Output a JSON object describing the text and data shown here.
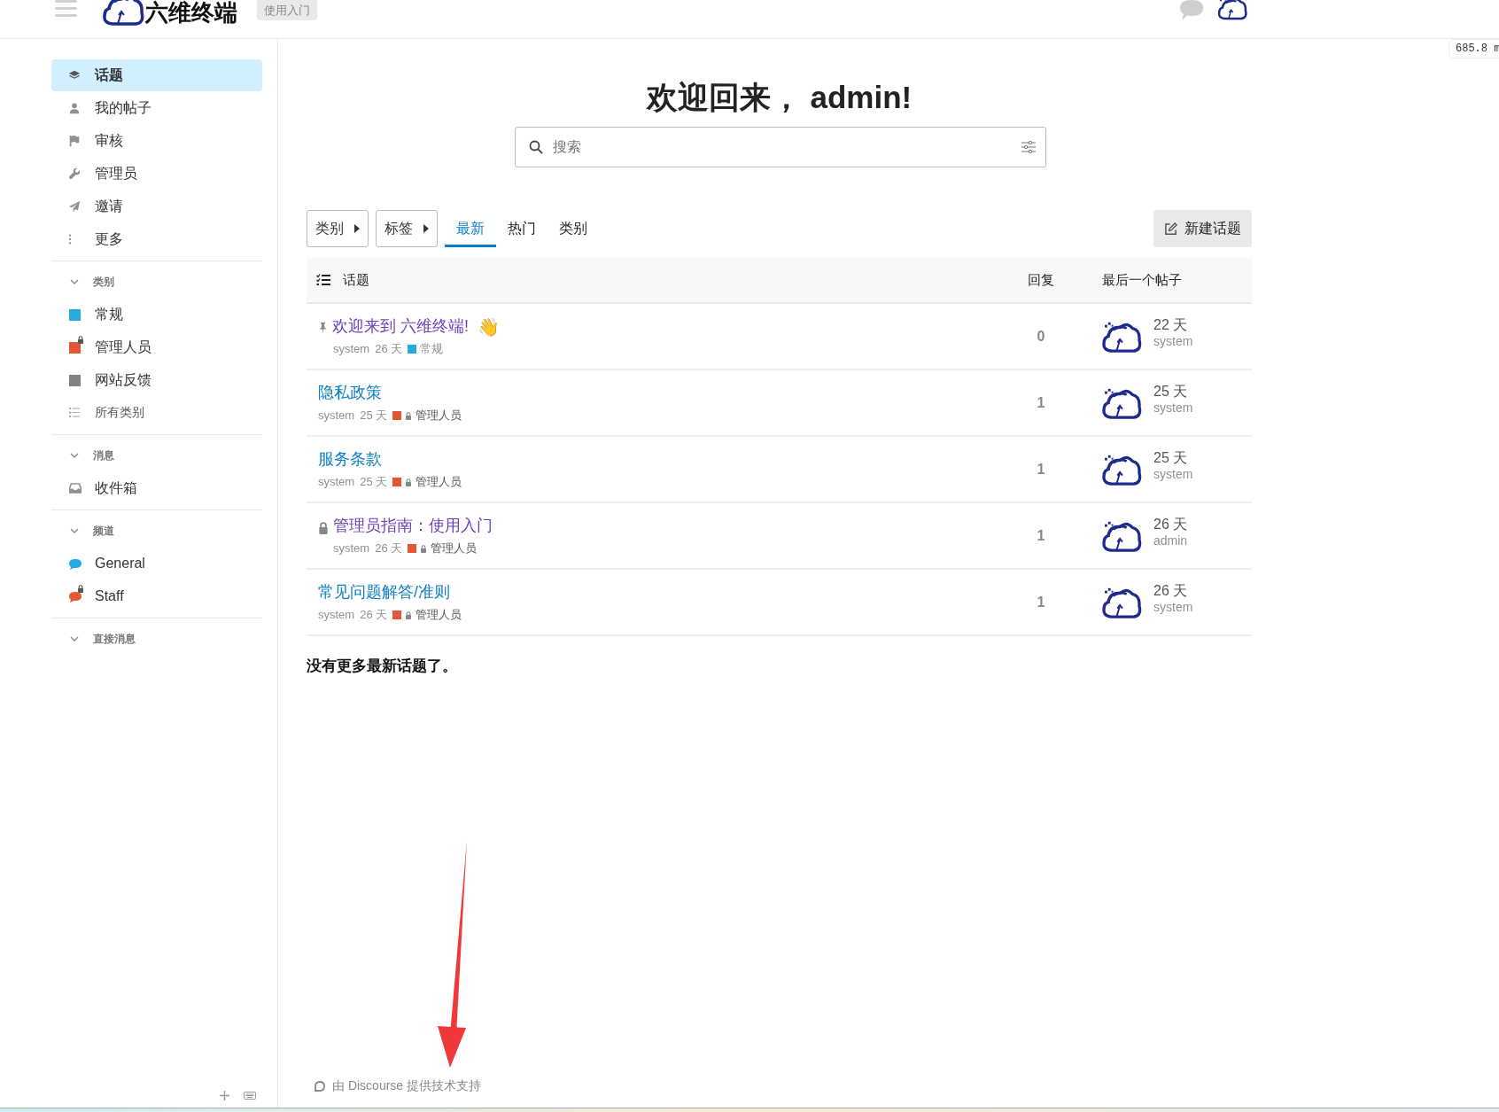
{
  "header": {
    "site_name": "六维终端",
    "badge": "使用入门",
    "overlay_reading": "685.8 m"
  },
  "sidebar": {
    "nav": [
      {
        "label": "话题",
        "kind": "layers",
        "selected": true
      },
      {
        "label": "我的帖子",
        "kind": "user",
        "selected": false
      },
      {
        "label": "审核",
        "kind": "flag",
        "selected": false
      },
      {
        "label": "管理员",
        "kind": "wrench",
        "selected": false
      },
      {
        "label": "邀请",
        "kind": "plane",
        "selected": false
      },
      {
        "label": "更多",
        "kind": "dots",
        "selected": false
      }
    ],
    "sections": [
      {
        "title": "类别",
        "expanded": true,
        "items": [
          {
            "label": "常规",
            "kind": "category",
            "color": "#25aae1",
            "locked": false
          },
          {
            "label": "管理人员",
            "kind": "category",
            "color": "#e45735",
            "locked": true
          },
          {
            "label": "网站反馈",
            "kind": "category",
            "color": "#808281",
            "locked": false
          },
          {
            "label": "所有类别",
            "kind": "list"
          }
        ]
      },
      {
        "title": "消息",
        "expanded": true,
        "items": [
          {
            "label": "收件箱",
            "kind": "inbox"
          }
        ]
      },
      {
        "title": "频道",
        "expanded": true,
        "items": [
          {
            "label": "General",
            "kind": "channel",
            "color": "#25aae1",
            "locked": false
          },
          {
            "label": "Staff",
            "kind": "channel",
            "color": "#e45735",
            "locked": true
          }
        ]
      },
      {
        "title": "直接消息",
        "expanded": true
      }
    ]
  },
  "main": {
    "welcome": "欢迎回来， admin!",
    "search": {
      "placeholder": "搜索"
    },
    "filters": [
      {
        "label": "类别"
      },
      {
        "label": "标签"
      }
    ],
    "tabs": [
      {
        "label": "最新",
        "selected": true
      },
      {
        "label": "热门",
        "selected": false
      },
      {
        "label": "类别",
        "selected": false
      }
    ],
    "new_topic_button": "新建话题",
    "table": {
      "columns": [
        "话题",
        "回复",
        "最后一个帖子"
      ],
      "rows": [
        {
          "pinned": true,
          "locked": false,
          "title": "欢迎来到 六维终端!",
          "emoji": "👋",
          "visited": true,
          "poster": "system",
          "age": "26 天",
          "category": {
            "name": "常规",
            "color": "#25aae1",
            "locked": false
          },
          "replies": "0",
          "last_age": "22 天",
          "last_user": "system"
        },
        {
          "pinned": false,
          "locked": false,
          "title": "隐私政策",
          "visited": false,
          "poster": "system",
          "age": "25 天",
          "category": {
            "name": "管理人员",
            "color": "#e45735",
            "locked": true
          },
          "replies": "1",
          "last_age": "25 天",
          "last_user": "system"
        },
        {
          "pinned": false,
          "locked": false,
          "title": "服务条款",
          "visited": false,
          "poster": "system",
          "age": "25 天",
          "category": {
            "name": "管理人员",
            "color": "#e45735",
            "locked": true
          },
          "replies": "1",
          "last_age": "25 天",
          "last_user": "system"
        },
        {
          "pinned": false,
          "locked": true,
          "title": "管理员指南：使用入门",
          "visited": true,
          "poster": "system",
          "age": "26 天",
          "category": {
            "name": "管理人员",
            "color": "#e45735",
            "locked": true
          },
          "replies": "1",
          "last_age": "26 天",
          "last_user": "admin"
        },
        {
          "pinned": false,
          "locked": false,
          "title": "常见问题解答/准则",
          "visited": false,
          "poster": "system",
          "age": "26 天",
          "category": {
            "name": "管理人员",
            "color": "#e45735",
            "locked": true
          },
          "replies": "1",
          "last_age": "26 天",
          "last_user": "system"
        }
      ]
    },
    "end_note": "没有更多最新话题了。",
    "footer": "由 Discourse 提供技术支持"
  }
}
